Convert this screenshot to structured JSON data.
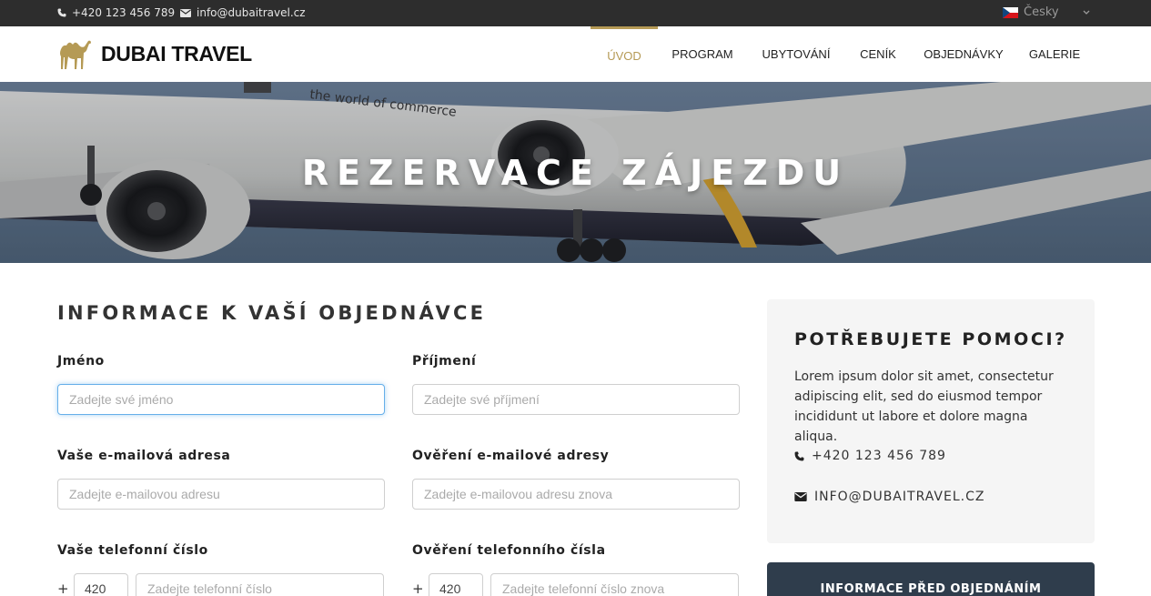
{
  "topbar": {
    "phone": "+420 123 456 789",
    "email": "info@dubaitravel.cz",
    "language": "Česky",
    "icons": {
      "phone": "phone-icon",
      "email": "envelope-icon",
      "flag": "czech-flag-icon",
      "chevron": "chevron-down-icon"
    }
  },
  "header": {
    "logo_text": "DUBAI TRAVEL",
    "logo_icon": "camel-icon",
    "nav": [
      {
        "label": "ÚVOD",
        "active": true
      },
      {
        "label": "PROGRAM",
        "active": false
      },
      {
        "label": "UBYTOVÁNÍ",
        "active": false
      },
      {
        "label": "CENÍK",
        "active": false
      },
      {
        "label": "OBJEDNÁVKY",
        "active": false
      },
      {
        "label": "GALERIE",
        "active": false
      }
    ]
  },
  "hero": {
    "title": "REZERVACE ZÁJEZDU",
    "image_text": "the world of commerce"
  },
  "form": {
    "title": "INFORMACE K VAŠÍ OBJEDNÁVCE",
    "first_name": {
      "label": "Jméno",
      "placeholder": "Zadejte své jméno"
    },
    "last_name": {
      "label": "Příjmení",
      "placeholder": "Zadejte své příjmení"
    },
    "email": {
      "label": "Vaše e-mailová adresa",
      "placeholder": "Zadejte e-mailovou adresu"
    },
    "email_confirm": {
      "label": "Ověření e-mailové adresy",
      "placeholder": "Zadejte e-mailovou adresu znova"
    },
    "phone": {
      "label": "Vaše telefonní číslo",
      "prefix": "+",
      "code": "420",
      "placeholder": "Zadejte telefonní číslo"
    },
    "phone_confirm": {
      "label": "Ověření telefonního čísla",
      "prefix": "+",
      "code": "420",
      "placeholder": "Zadejte telefonní číslo znova"
    }
  },
  "sidebar": {
    "help_title": "POTŘEBUJETE POMOCI?",
    "help_text": "Lorem ipsum dolor sit amet, consectetur adipiscing elit, sed do eiusmod tempor incididunt ut labore et dolore magna aliqua.",
    "phone": "+420 123 456 789",
    "email": "INFO@DUBAITRAVEL.CZ",
    "info_title": "INFORMACE PŘED OBJEDNÁNÍM"
  },
  "colors": {
    "accent": "#b59a55",
    "topbar": "#2d2d2d",
    "sidebar_dark": "#2f3d4c",
    "focus": "#66afe9"
  }
}
